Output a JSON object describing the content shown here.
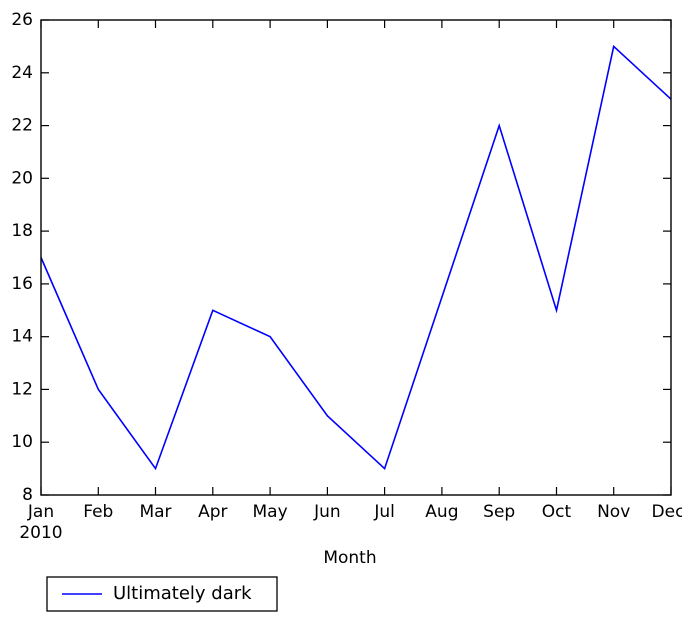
{
  "chart_data": {
    "type": "line",
    "title": "",
    "xlabel": "Month",
    "ylabel": "",
    "categories": [
      "Jan",
      "Feb",
      "Mar",
      "Apr",
      "May",
      "Jun",
      "Jul",
      "Aug",
      "Sep",
      "Oct",
      "Nov",
      "Dec"
    ],
    "x_sublabel": "2010",
    "series": [
      {
        "name": "Ultimately dark",
        "color": "#0000ff",
        "values": [
          17,
          12,
          9,
          15,
          14,
          11,
          9,
          15.5,
          22,
          15,
          25,
          23
        ]
      }
    ],
    "ylim": [
      8,
      26
    ],
    "yticks": [
      8,
      10,
      12,
      14,
      16,
      18,
      20,
      22,
      24,
      26
    ],
    "ytick_labels": [
      "8",
      "10",
      "12",
      "14",
      "16",
      "18",
      "20",
      "22",
      "24",
      "26"
    ],
    "xticks": [
      "Jan",
      "Feb",
      "Mar",
      "Apr",
      "May",
      "Jun",
      "Jul",
      "Aug",
      "Sep",
      "Oct",
      "Nov",
      "Dec"
    ],
    "grid": false,
    "legend_position": "below-left",
    "notes": "August value lies on the straight segment between Jul (9) and Sep (22); no vertex is drawn at Aug."
  },
  "axes": {
    "ytick_labels": [
      "26",
      "24",
      "22",
      "20",
      "18",
      "16",
      "14",
      "12",
      "10",
      "8"
    ],
    "xtick_labels": [
      "Jan",
      "Feb",
      "Mar",
      "Apr",
      "May",
      "Jun",
      "Jul",
      "Aug",
      "Sep",
      "Oct",
      "Nov",
      "Dec"
    ],
    "x_year_label": "2010",
    "x_axis_title": "Month"
  },
  "legend": {
    "entries": [
      {
        "label": "Ultimately dark",
        "color": "#0000ff"
      }
    ]
  },
  "style": {
    "line_color": "#0000ff",
    "frame_color": "#000000",
    "background": "#ffffff",
    "text_color": "#000000"
  }
}
